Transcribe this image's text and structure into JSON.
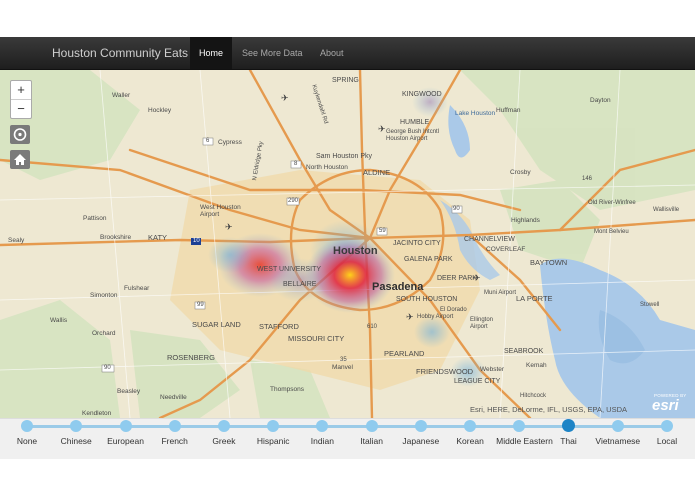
{
  "navbar": {
    "brand": "Houston Community Eats",
    "items": [
      {
        "label": "Home"
      },
      {
        "label": "See More Data"
      },
      {
        "label": "About"
      }
    ]
  },
  "map": {
    "zoom_in": "+",
    "zoom_out": "−",
    "attribution": "Esri, HERE, DeLorme, IFL, USGS, EPA, USDA",
    "powered_by": "POWERED BY",
    "esri_logo": "esri",
    "place_labels": {
      "houston": "Houston",
      "pasadena": "Pasadena",
      "katy": "KATY",
      "sugar_land": "SUGAR LAND",
      "stafford": "STAFFORD",
      "missouri_city": "MISSOURI CITY",
      "rosenberg": "ROSENBERG",
      "humble": "HUMBLE",
      "kingwood": "KINGWOOD",
      "spring": "SPRING",
      "aldine": "ALDINE",
      "baytown": "BAYTOWN",
      "la_porte": "LA PORTE",
      "seabrook": "SEABROOK",
      "pearland": "PEARLAND",
      "friendswood": "FRIENDSWOOD",
      "league_city": "LEAGUE CITY",
      "south_houston": "SOUTH HOUSTON",
      "deer_park": "DEER PARK",
      "galena_park": "GALENA PARK",
      "jacinto_city": "JACINTO CITY",
      "channelview": "CHANNELVIEW",
      "west_university": "WEST UNIVERSITY",
      "bellaire": "BELLAIRE",
      "highlands": "Highlands",
      "brookshire": "Brookshire",
      "simonton": "Simonton",
      "fulshear": "Fulshear",
      "orchard": "Orchard",
      "beasley": "Beasley",
      "kendleton": "Kendleton",
      "thompsons": "Thompsons",
      "needville": "Needville",
      "hockley": "Hockley",
      "waller": "Waller",
      "cypress": "Cypress",
      "crosby": "Crosby",
      "huffman": "Huffman",
      "dayton": "Dayton",
      "pattison": "Pattison",
      "wallis": "Wallis",
      "manvel": "Manvel",
      "hitchcock": "Hitchcock",
      "kemah": "Kemah",
      "webster": "Webster",
      "sealy": "Sealy",
      "lake_houston": "Lake Houston",
      "sam_houston_pky": "Sam Houston Pky",
      "north_houston": "North Houston",
      "west_houston_airport": "West Houston Airport",
      "bush_airport": "George Bush Intcntl Houston Airport",
      "hobby_airport": "Hobby Airport",
      "ellington_airport": "Ellington Airport",
      "muni_airport": "Muni Airport",
      "wallisville": "Wallisville",
      "old_river_winfree": "Old River-Winfree",
      "mont_belvieu": "Mont Belvieu",
      "coverleaf": "COVERLEAF",
      "el_dorado": "El Dorado",
      "stowell": "Stowell",
      "n_eldridge_pky": "N Eldridge Pky",
      "kuykendahl_rd": "Kuykendahl Rd",
      "hwy_6": "6",
      "hwy_8": "8",
      "hwy_59": "59",
      "hwy_90": "90",
      "hwy_99": "99",
      "hwy_290": "290",
      "hwy_10": "10",
      "hwy_146": "146",
      "hwy_610": "610",
      "hwy_35": "35"
    }
  },
  "slider": {
    "options": [
      {
        "label": "None"
      },
      {
        "label": "Chinese"
      },
      {
        "label": "European"
      },
      {
        "label": "French"
      },
      {
        "label": "Greek"
      },
      {
        "label": "Hispanic"
      },
      {
        "label": "Indian"
      },
      {
        "label": "Italian"
      },
      {
        "label": "Japanese"
      },
      {
        "label": "Korean"
      },
      {
        "label": "Middle Eastern"
      },
      {
        "label": "Thai"
      },
      {
        "label": "Vietnamese"
      },
      {
        "label": "Local"
      }
    ],
    "selected": "Thai"
  },
  "colors": {
    "navbar": "#222222",
    "slider_track": "#9bcbe8",
    "slider_selected": "#1d84c6",
    "water": "#aac9e8",
    "highways": "#e59a4e",
    "urban": "#f0d9a8"
  }
}
